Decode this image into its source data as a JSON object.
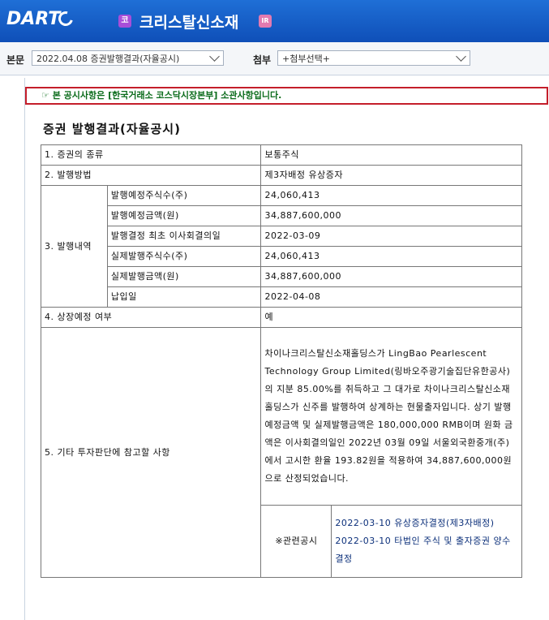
{
  "header": {
    "logo_text": "DART",
    "company_badge": "코",
    "company_name": "크리스탈신소재",
    "ir_badge": "IR"
  },
  "filter": {
    "report_label": "본문",
    "report_value": "2022.04.08  증권발행결과(자율공시)",
    "attach_label": "첨부",
    "attach_value": "+첨부선택+"
  },
  "notice": {
    "icon": "☞",
    "text": "본 공시사항은 [한국거래소 코스닥시장본부] 소관사항입니다."
  },
  "doc": {
    "title": "증권 발행결과(자율공시)",
    "rows": {
      "kind_label": "1. 증권의 종류",
      "kind_value": "보통주식",
      "method_label": "2. 발행방법",
      "method_value": "제3자배정 유상증자",
      "detail_label": "3. 발행내역",
      "planned_shares_label": "발행예정주식수(주)",
      "planned_shares_value": "24,060,413",
      "planned_amount_label": "발행예정금액(원)",
      "planned_amount_value": "34,887,600,000",
      "board_date_label": "발행결정 최초 이사회결의일",
      "board_date_value": "2022-03-09",
      "actual_shares_label": "실제발행주식수(주)",
      "actual_shares_value": "24,060,413",
      "actual_amount_label": "실제발행금액(원)",
      "actual_amount_value": "34,887,600,000",
      "payment_date_label": "납입일",
      "payment_date_value": "2022-04-08",
      "listing_label": "4. 상장예정 여부",
      "listing_value": "예",
      "other_label": "5. 기타 투자판단에 참고할 사항",
      "other_text": "차이나크리스탈신소재홀딩스가 LingBao Pearlescent Technology Group Limited(링바오주광기술집단유한공사)의 지분 85.00%를 취득하고 그 대가로 차이나크리스탈신소재홀딩스가 신주를 발행하여 상계하는 현물출자입니다. 상기 발행예정금액 및 실제발행금액은 180,000,000 RMB이며 원화 금액은 이사회결의일인 2022년 03월 09일 서울외국환중개(주)에서 고시한 환율 193.82원을 적용하여 34,887,600,000원으로 산정되었습니다.",
      "related_label": "※관련공시",
      "related_1": "2022-03-10 유상증자결정(제3자배정)",
      "related_2": "2022-03-10 타법인 주식 및 출자증권 양수결정"
    }
  }
}
